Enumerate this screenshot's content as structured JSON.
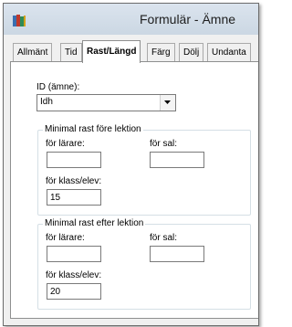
{
  "window": {
    "title": "Formulär - Ämne"
  },
  "tabs": [
    {
      "label": "Allmänt"
    },
    {
      "label": "Tid"
    },
    {
      "label": "Rast/Längd"
    },
    {
      "label": "Färg"
    },
    {
      "label": "Dölj"
    },
    {
      "label": "Undanta"
    }
  ],
  "id_field": {
    "label": "ID (ämne):",
    "value": "Idh"
  },
  "before": {
    "title": "Minimal rast före lektion",
    "teacher_label": "för lärare:",
    "teacher_value": "",
    "room_label": "för sal:",
    "room_value": "",
    "class_label": "för klass/elev:",
    "class_value": "15"
  },
  "after": {
    "title": "Minimal rast efter lektion",
    "teacher_label": "för lärare:",
    "teacher_value": "",
    "room_label": "för sal:",
    "room_value": "",
    "class_label": "för klass/elev:",
    "class_value": "20"
  }
}
